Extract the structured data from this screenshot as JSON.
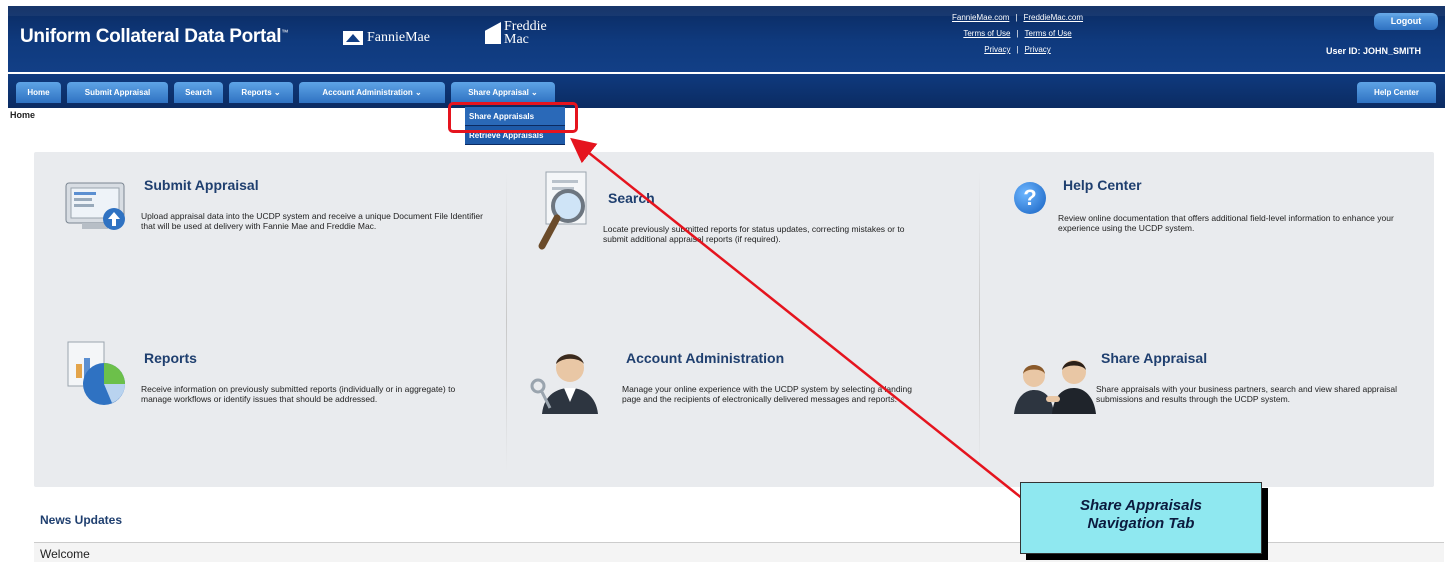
{
  "header": {
    "portal_title": "Uniform Collateral Data Portal",
    "trademark": "™",
    "fannie_logo": "FannieMae",
    "freddie_logo_line1": "Freddie",
    "freddie_logo_line2": "Mac",
    "links_row1_left": "FannieMae.com",
    "links_row1_right": "FreddieMac.com",
    "links_row2_left": "Terms of Use",
    "links_row2_right": "Terms of Use",
    "links_row3_left": "Privacy",
    "links_row3_right": "Privacy",
    "separator": "|",
    "logout_label": "Logout",
    "user_id": "User ID: JOHN_SMITH"
  },
  "nav": {
    "tabs": [
      {
        "label": "Home"
      },
      {
        "label": "Submit Appraisal"
      },
      {
        "label": "Search"
      },
      {
        "label": "Reports ⌄"
      },
      {
        "label": "Account Administration ⌄"
      },
      {
        "label": "Share Appraisal ⌄"
      }
    ],
    "help_center": "Help Center"
  },
  "breadcrumb": "Home",
  "dropdown": {
    "items": [
      {
        "label": "Share Appraisals"
      },
      {
        "label": "Retrieve Appraisals"
      }
    ]
  },
  "cards": {
    "submit": {
      "title": "Submit Appraisal",
      "desc": "Upload appraisal data into the UCDP system and receive a unique Document File Identifier that will be used at delivery with Fannie Mae and Freddie Mac."
    },
    "search": {
      "title": "Search",
      "desc": "Locate previously submitted reports for status updates, correcting mistakes or to submit additional appraisal reports (if required)."
    },
    "help": {
      "title": "Help Center",
      "desc": "Review online documentation that offers additional field-level information to enhance your experience using the UCDP system.",
      "icon_glyph": "?"
    },
    "reports": {
      "title": "Reports",
      "desc": "Receive information on previously submitted reports (individually or in aggregate) to manage workflows or identify issues that should be addressed."
    },
    "account": {
      "title": "Account Administration",
      "desc": "Manage your online experience with the UCDP system by selecting a landing page and the recipients of electronically delivered messages and reports."
    },
    "share": {
      "title": "Share Appraisal",
      "desc": "Share appraisals with your business partners, search and view shared appraisal submissions and results through the UCDP system."
    }
  },
  "news": {
    "title": "News Updates",
    "welcome": "Welcome"
  },
  "callout": {
    "line1": "Share Appraisals",
    "line2": "Navigation Tab"
  },
  "colors": {
    "header_bg": "#0f3a7e",
    "tab_bg": "#2f72c2",
    "highlight": "#e5141e",
    "callout_bg": "#8fe8f0",
    "title_text": "#1f3f6f"
  },
  "icons": {
    "submit": "monitor-upload-icon",
    "search": "magnifier-document-icon",
    "help": "question-mark-icon",
    "reports": "report-chart-icon",
    "account": "user-keys-icon",
    "share": "business-partners-icon"
  }
}
